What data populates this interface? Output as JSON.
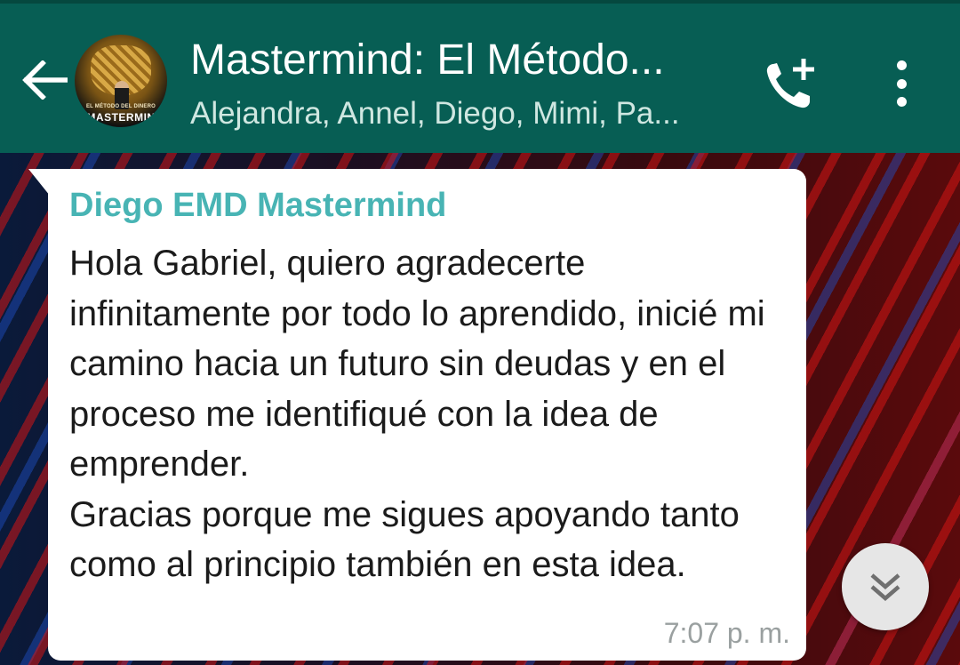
{
  "header": {
    "title": "Mastermind: El Método...",
    "participants": "Alejandra, Annel, Diego, Mimi, Pa...",
    "back_icon": "arrow-left-icon",
    "call_icon": "add-call-icon",
    "menu_icon": "more-vert-icon",
    "avatar": {
      "line1": "EL MÉTODO DEL DINERO",
      "line2": "MASTERMIN"
    },
    "color": "#075e54"
  },
  "message": {
    "sender": "Diego EMD Mastermind",
    "sender_color": "#48b4b4",
    "text": "Hola Gabriel, quiero agradecerte infinitamente por todo lo aprendido, inicié mi camino hacia un futuro sin deudas y en el proceso me identifiqué con la idea de emprender.\nGracias porque me sigues apoyando tanto como al principio también en esta idea.",
    "time": "7:07 p. m."
  },
  "scroll_button": {
    "icon": "double-chevron-down-icon"
  }
}
